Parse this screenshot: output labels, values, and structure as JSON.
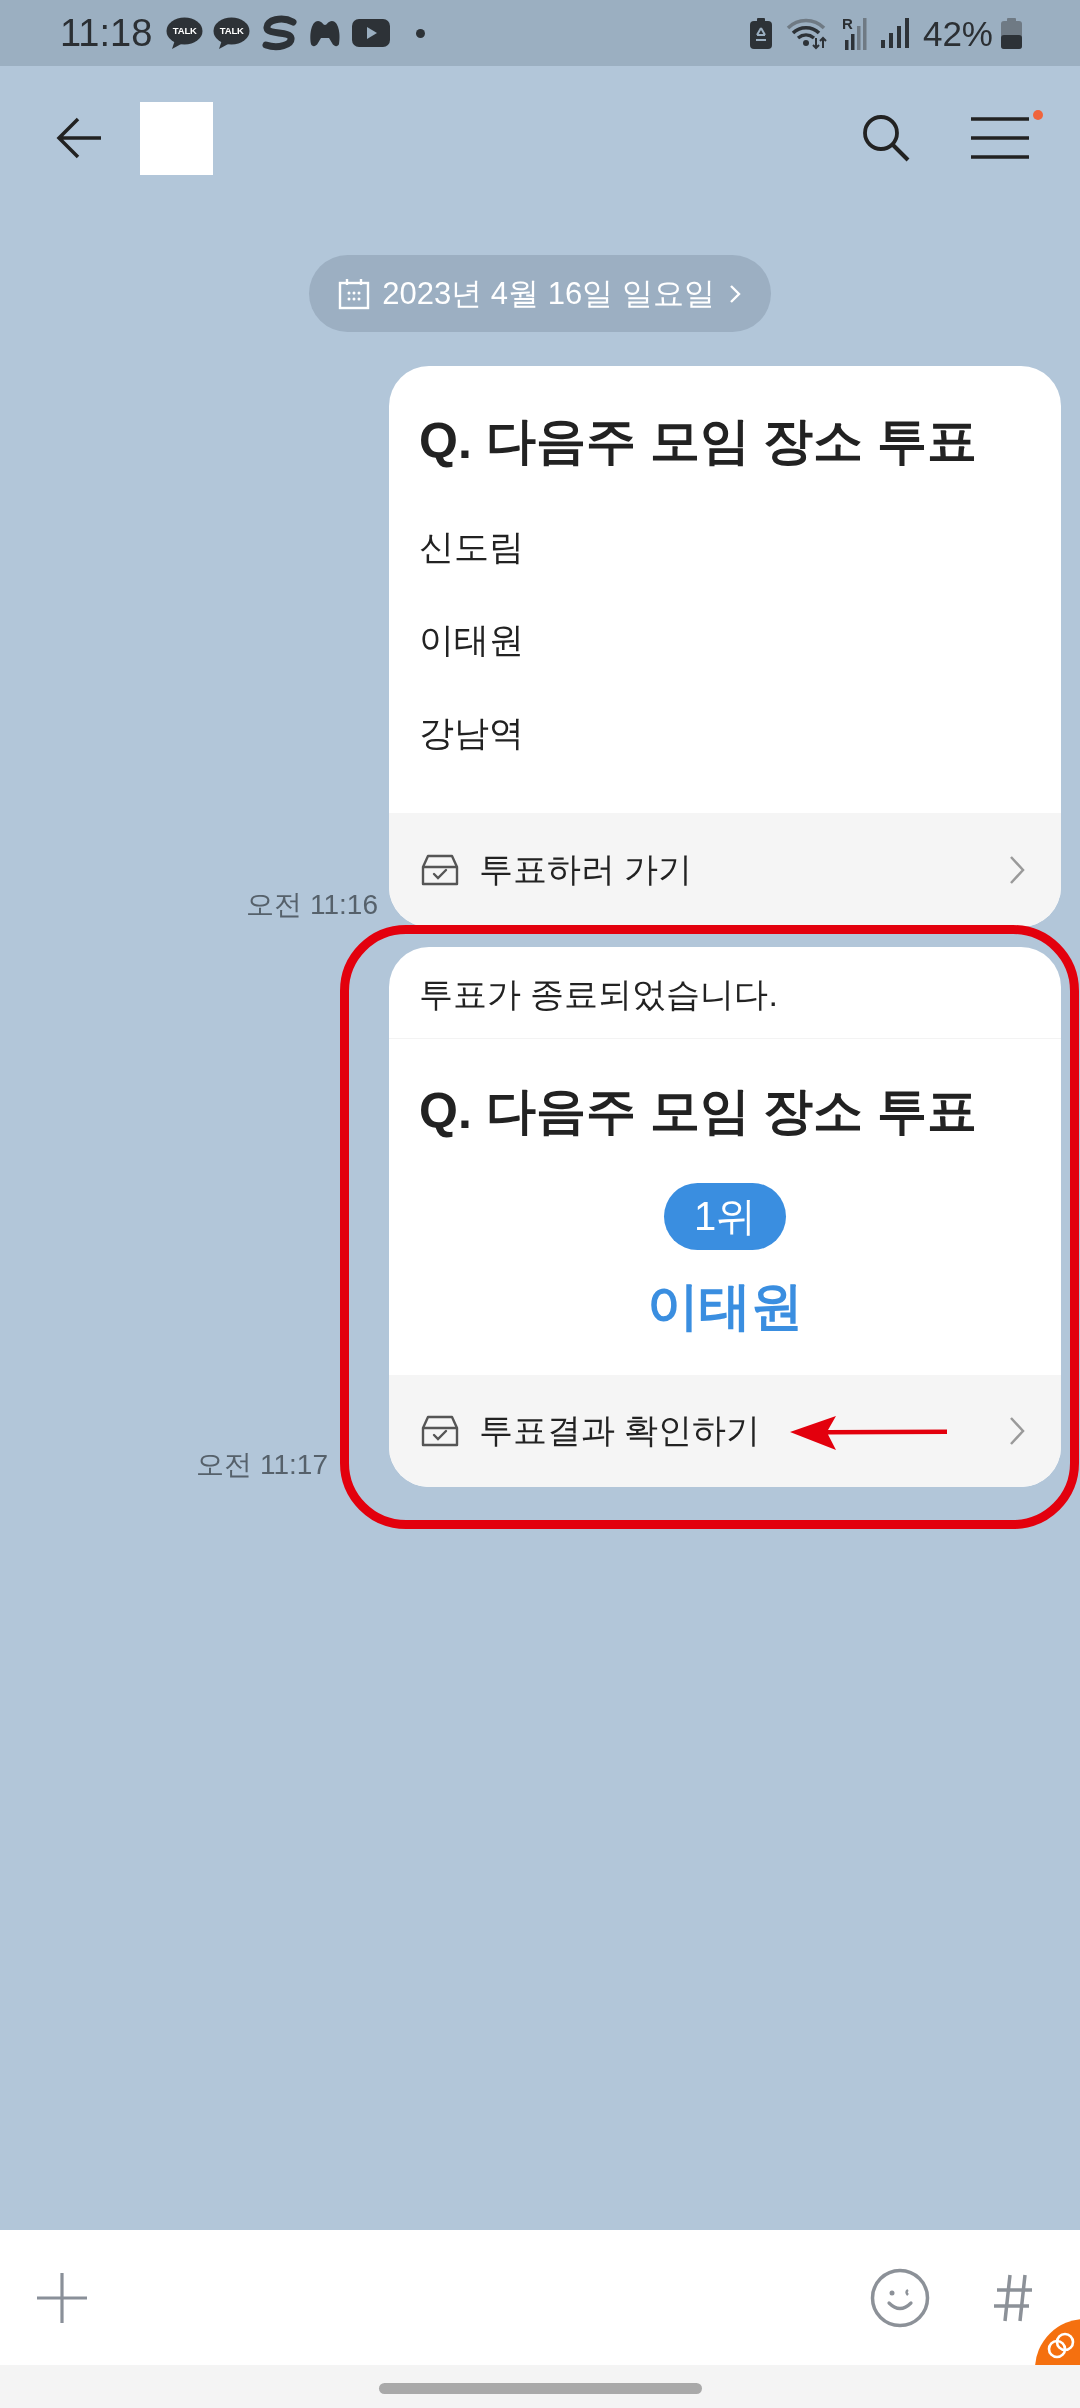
{
  "status_bar": {
    "time": "11:18",
    "notification_icons": [
      {
        "kind": "talk",
        "label": "TALK"
      },
      {
        "kind": "talk",
        "label": "TALK"
      },
      {
        "kind": "swirl"
      },
      {
        "kind": "controller"
      },
      {
        "kind": "play"
      },
      {
        "kind": "dot"
      }
    ],
    "roaming": "R",
    "battery": "42%"
  },
  "header": {
    "menu_badge": true
  },
  "date_divider": "2023년 4월 16일 일요일",
  "messages": [
    {
      "kind": "poll",
      "highlighted": false,
      "title": "Q. 다음주 모임 장소 투표",
      "options": [
        "신도림",
        "이태원",
        "강남역"
      ],
      "action": "투표하러 가기",
      "time": "오전 11:16"
    },
    {
      "kind": "poll_result",
      "highlighted": true,
      "notice": "투표가 종료되었습니다.",
      "title": "Q. 다음주 모임 장소 투표",
      "rank": "1위",
      "winner": "이태원",
      "action": "투표결과 확인하기",
      "time": "오전 11:17"
    }
  ]
}
